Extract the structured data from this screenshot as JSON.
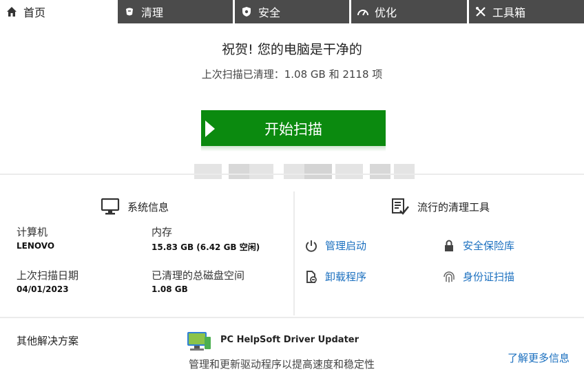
{
  "tabs": [
    {
      "label": "首页",
      "icon": "home-icon"
    },
    {
      "label": "清理",
      "icon": "broom-icon"
    },
    {
      "label": "安全",
      "icon": "shield-icon"
    },
    {
      "label": "优化",
      "icon": "speedometer-icon"
    },
    {
      "label": "工具箱",
      "icon": "tools-icon"
    }
  ],
  "hero": {
    "title": "祝贺! 您的电脑是干净的",
    "subtitle": "上次扫描已清理：1.08 GB 和 2118 项",
    "scan_button": "开始扫描"
  },
  "system_info": {
    "heading": "系统信息",
    "computer_label": "计算机",
    "computer_value": "LENOVO",
    "memory_label": "内存",
    "memory_value": "15.83 GB (6.42 GB 空闲)",
    "last_scan_label": "上次扫描日期",
    "last_scan_value": "04/01/2023",
    "disk_cleaned_label": "已清理的总磁盘空间",
    "disk_cleaned_value": "1.08 GB"
  },
  "popular_tools": {
    "heading": "流行的清理工具",
    "items": [
      {
        "label": "管理启动",
        "icon": "power-icon"
      },
      {
        "label": "安全保险库",
        "icon": "lock-icon"
      },
      {
        "label": "卸载程序",
        "icon": "uninstall-icon"
      },
      {
        "label": "身份证扫描",
        "icon": "fingerprint-icon"
      }
    ]
  },
  "other_solutions": {
    "heading": "其他解决方案",
    "product_name": "PC HelpSoft Driver Updater",
    "product_desc": "管理和更新驱动程序以提高速度和稳定性",
    "learn_more": "了解更多信息"
  },
  "colors": {
    "accent_green": "#0b8a0f",
    "link_blue": "#1a6fbf",
    "tab_dark": "#4b4b4b"
  }
}
